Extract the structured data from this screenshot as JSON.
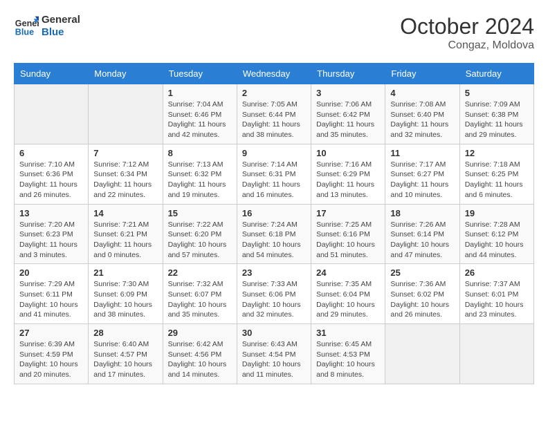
{
  "header": {
    "logo_line1": "General",
    "logo_line2": "Blue",
    "month": "October 2024",
    "location": "Congaz, Moldova"
  },
  "weekdays": [
    "Sunday",
    "Monday",
    "Tuesday",
    "Wednesday",
    "Thursday",
    "Friday",
    "Saturday"
  ],
  "weeks": [
    [
      {
        "day": "",
        "info": ""
      },
      {
        "day": "",
        "info": ""
      },
      {
        "day": "1",
        "info": "Sunrise: 7:04 AM\nSunset: 6:46 PM\nDaylight: 11 hours and 42 minutes."
      },
      {
        "day": "2",
        "info": "Sunrise: 7:05 AM\nSunset: 6:44 PM\nDaylight: 11 hours and 38 minutes."
      },
      {
        "day": "3",
        "info": "Sunrise: 7:06 AM\nSunset: 6:42 PM\nDaylight: 11 hours and 35 minutes."
      },
      {
        "day": "4",
        "info": "Sunrise: 7:08 AM\nSunset: 6:40 PM\nDaylight: 11 hours and 32 minutes."
      },
      {
        "day": "5",
        "info": "Sunrise: 7:09 AM\nSunset: 6:38 PM\nDaylight: 11 hours and 29 minutes."
      }
    ],
    [
      {
        "day": "6",
        "info": "Sunrise: 7:10 AM\nSunset: 6:36 PM\nDaylight: 11 hours and 26 minutes."
      },
      {
        "day": "7",
        "info": "Sunrise: 7:12 AM\nSunset: 6:34 PM\nDaylight: 11 hours and 22 minutes."
      },
      {
        "day": "8",
        "info": "Sunrise: 7:13 AM\nSunset: 6:32 PM\nDaylight: 11 hours and 19 minutes."
      },
      {
        "day": "9",
        "info": "Sunrise: 7:14 AM\nSunset: 6:31 PM\nDaylight: 11 hours and 16 minutes."
      },
      {
        "day": "10",
        "info": "Sunrise: 7:16 AM\nSunset: 6:29 PM\nDaylight: 11 hours and 13 minutes."
      },
      {
        "day": "11",
        "info": "Sunrise: 7:17 AM\nSunset: 6:27 PM\nDaylight: 11 hours and 10 minutes."
      },
      {
        "day": "12",
        "info": "Sunrise: 7:18 AM\nSunset: 6:25 PM\nDaylight: 11 hours and 6 minutes."
      }
    ],
    [
      {
        "day": "13",
        "info": "Sunrise: 7:20 AM\nSunset: 6:23 PM\nDaylight: 11 hours and 3 minutes."
      },
      {
        "day": "14",
        "info": "Sunrise: 7:21 AM\nSunset: 6:21 PM\nDaylight: 11 hours and 0 minutes."
      },
      {
        "day": "15",
        "info": "Sunrise: 7:22 AM\nSunset: 6:20 PM\nDaylight: 10 hours and 57 minutes."
      },
      {
        "day": "16",
        "info": "Sunrise: 7:24 AM\nSunset: 6:18 PM\nDaylight: 10 hours and 54 minutes."
      },
      {
        "day": "17",
        "info": "Sunrise: 7:25 AM\nSunset: 6:16 PM\nDaylight: 10 hours and 51 minutes."
      },
      {
        "day": "18",
        "info": "Sunrise: 7:26 AM\nSunset: 6:14 PM\nDaylight: 10 hours and 47 minutes."
      },
      {
        "day": "19",
        "info": "Sunrise: 7:28 AM\nSunset: 6:12 PM\nDaylight: 10 hours and 44 minutes."
      }
    ],
    [
      {
        "day": "20",
        "info": "Sunrise: 7:29 AM\nSunset: 6:11 PM\nDaylight: 10 hours and 41 minutes."
      },
      {
        "day": "21",
        "info": "Sunrise: 7:30 AM\nSunset: 6:09 PM\nDaylight: 10 hours and 38 minutes."
      },
      {
        "day": "22",
        "info": "Sunrise: 7:32 AM\nSunset: 6:07 PM\nDaylight: 10 hours and 35 minutes."
      },
      {
        "day": "23",
        "info": "Sunrise: 7:33 AM\nSunset: 6:06 PM\nDaylight: 10 hours and 32 minutes."
      },
      {
        "day": "24",
        "info": "Sunrise: 7:35 AM\nSunset: 6:04 PM\nDaylight: 10 hours and 29 minutes."
      },
      {
        "day": "25",
        "info": "Sunrise: 7:36 AM\nSunset: 6:02 PM\nDaylight: 10 hours and 26 minutes."
      },
      {
        "day": "26",
        "info": "Sunrise: 7:37 AM\nSunset: 6:01 PM\nDaylight: 10 hours and 23 minutes."
      }
    ],
    [
      {
        "day": "27",
        "info": "Sunrise: 6:39 AM\nSunset: 4:59 PM\nDaylight: 10 hours and 20 minutes."
      },
      {
        "day": "28",
        "info": "Sunrise: 6:40 AM\nSunset: 4:57 PM\nDaylight: 10 hours and 17 minutes."
      },
      {
        "day": "29",
        "info": "Sunrise: 6:42 AM\nSunset: 4:56 PM\nDaylight: 10 hours and 14 minutes."
      },
      {
        "day": "30",
        "info": "Sunrise: 6:43 AM\nSunset: 4:54 PM\nDaylight: 10 hours and 11 minutes."
      },
      {
        "day": "31",
        "info": "Sunrise: 6:45 AM\nSunset: 4:53 PM\nDaylight: 10 hours and 8 minutes."
      },
      {
        "day": "",
        "info": ""
      },
      {
        "day": "",
        "info": ""
      }
    ]
  ]
}
